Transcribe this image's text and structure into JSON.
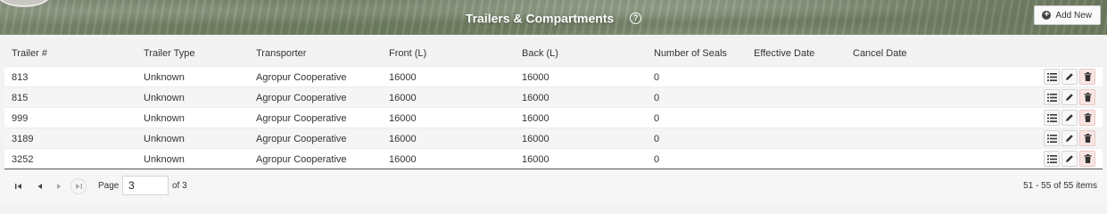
{
  "header": {
    "title": "Trailers & Compartments",
    "help_icon": "question-circle-icon",
    "add_label": "Add New",
    "add_icon": "plus-circle-icon"
  },
  "columns": [
    "Trailer #",
    "Trailer Type",
    "Transporter",
    "Front (L)",
    "Back (L)",
    "Number of Seals",
    "Effective Date",
    "Cancel Date"
  ],
  "rows": [
    {
      "trailer": "813",
      "type": "Unknown",
      "transporter": "Agropur Cooperative",
      "front": "16000",
      "back": "16000",
      "seals": "0",
      "effective": "",
      "cancel": ""
    },
    {
      "trailer": "815",
      "type": "Unknown",
      "transporter": "Agropur Cooperative",
      "front": "16000",
      "back": "16000",
      "seals": "0",
      "effective": "",
      "cancel": ""
    },
    {
      "trailer": "999",
      "type": "Unknown",
      "transporter": "Agropur Cooperative",
      "front": "16000",
      "back": "16000",
      "seals": "0",
      "effective": "",
      "cancel": ""
    },
    {
      "trailer": "3189",
      "type": "Unknown",
      "transporter": "Agropur Cooperative",
      "front": "16000",
      "back": "16000",
      "seals": "0",
      "effective": "",
      "cancel": ""
    },
    {
      "trailer": "3252",
      "type": "Unknown",
      "transporter": "Agropur Cooperative",
      "front": "16000",
      "back": "16000",
      "seals": "0",
      "effective": "",
      "cancel": ""
    }
  ],
  "row_actions": [
    "list-icon",
    "pencil-icon",
    "trash-icon"
  ],
  "pager": {
    "page_label": "Page",
    "current_page": "3",
    "of_label": "of 3",
    "items_info": "51 - 55 of 55 items"
  },
  "colors": {
    "delete_bg": "#f9e5e3",
    "header_text": "#ffffff"
  }
}
